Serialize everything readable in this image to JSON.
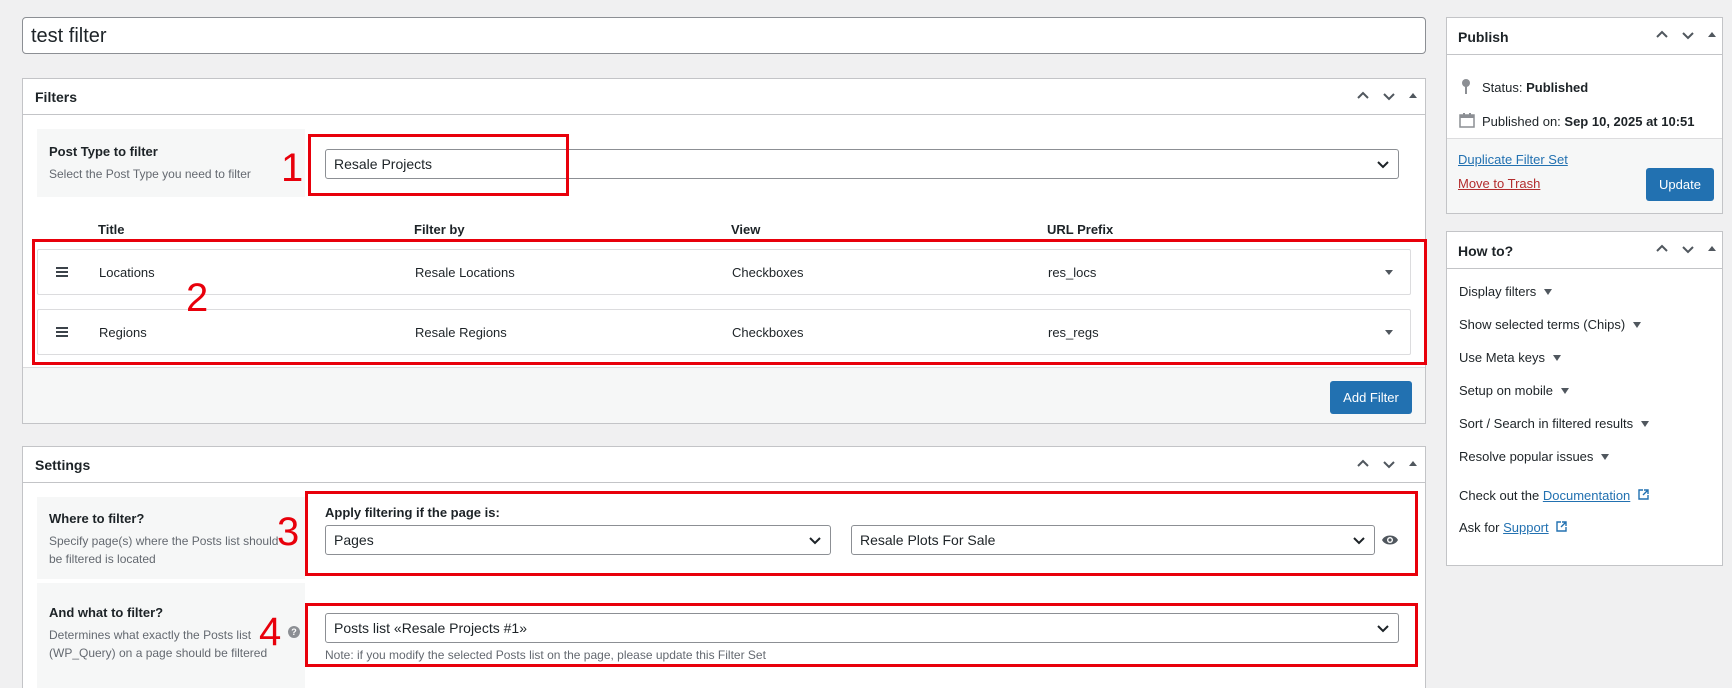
{
  "title_field": {
    "value": "test filter"
  },
  "filters_box": {
    "title": "Filters",
    "post_type": {
      "label": "Post Type to filter",
      "description": "Select the Post Type you need to filter",
      "value": "Resale Projects"
    },
    "columns": [
      "Title",
      "Filter by",
      "View",
      "URL Prefix"
    ],
    "rows": [
      {
        "title": "Locations",
        "filter_by": "Resale Locations",
        "view": "Checkboxes",
        "url_prefix": "res_locs"
      },
      {
        "title": "Regions",
        "filter_by": "Resale Regions",
        "view": "Checkboxes",
        "url_prefix": "res_regs"
      }
    ],
    "add_button": "Add Filter"
  },
  "settings_box": {
    "title": "Settings",
    "where": {
      "label": "Where to filter?",
      "description_line1": "Specify page(s) where the Posts list should",
      "description_line2": "be filtered is located",
      "apply_label": "Apply filtering if the page is:",
      "page_type": "Pages",
      "page_value": "Resale Plots For Sale"
    },
    "what": {
      "label": "And what to filter?",
      "description_line1": "Determines what exactly the Posts list",
      "description_line2": "(WP_Query) on a page should be filtered",
      "value": "Posts list «Resale Projects #1»",
      "note": "Note: if you modify the selected Posts list on the page, please update this Filter Set"
    }
  },
  "publish_box": {
    "title": "Publish",
    "status_label": "Status:",
    "status_value": "Published",
    "published_label": "Published on:",
    "published_value": "Sep 10, 2025 at 10:51",
    "duplicate_link": "Duplicate Filter Set",
    "trash_link": "Move to Trash",
    "update_button": "Update"
  },
  "howto_box": {
    "title": "How to?",
    "items": [
      "Display filters",
      "Show selected terms (Chips)",
      "Use Meta keys",
      "Setup on mobile",
      "Sort / Search in filtered results",
      "Resolve popular issues"
    ],
    "docs_prefix": "Check out the",
    "docs_link": "Documentation",
    "support_prefix": "Ask for",
    "support_link": "Support"
  },
  "annotations": [
    "1",
    "2",
    "3",
    "4"
  ],
  "colors": {
    "accent": "#2271b1",
    "annotation_red": "#e8000b",
    "trash_red": "#b32d2e"
  }
}
